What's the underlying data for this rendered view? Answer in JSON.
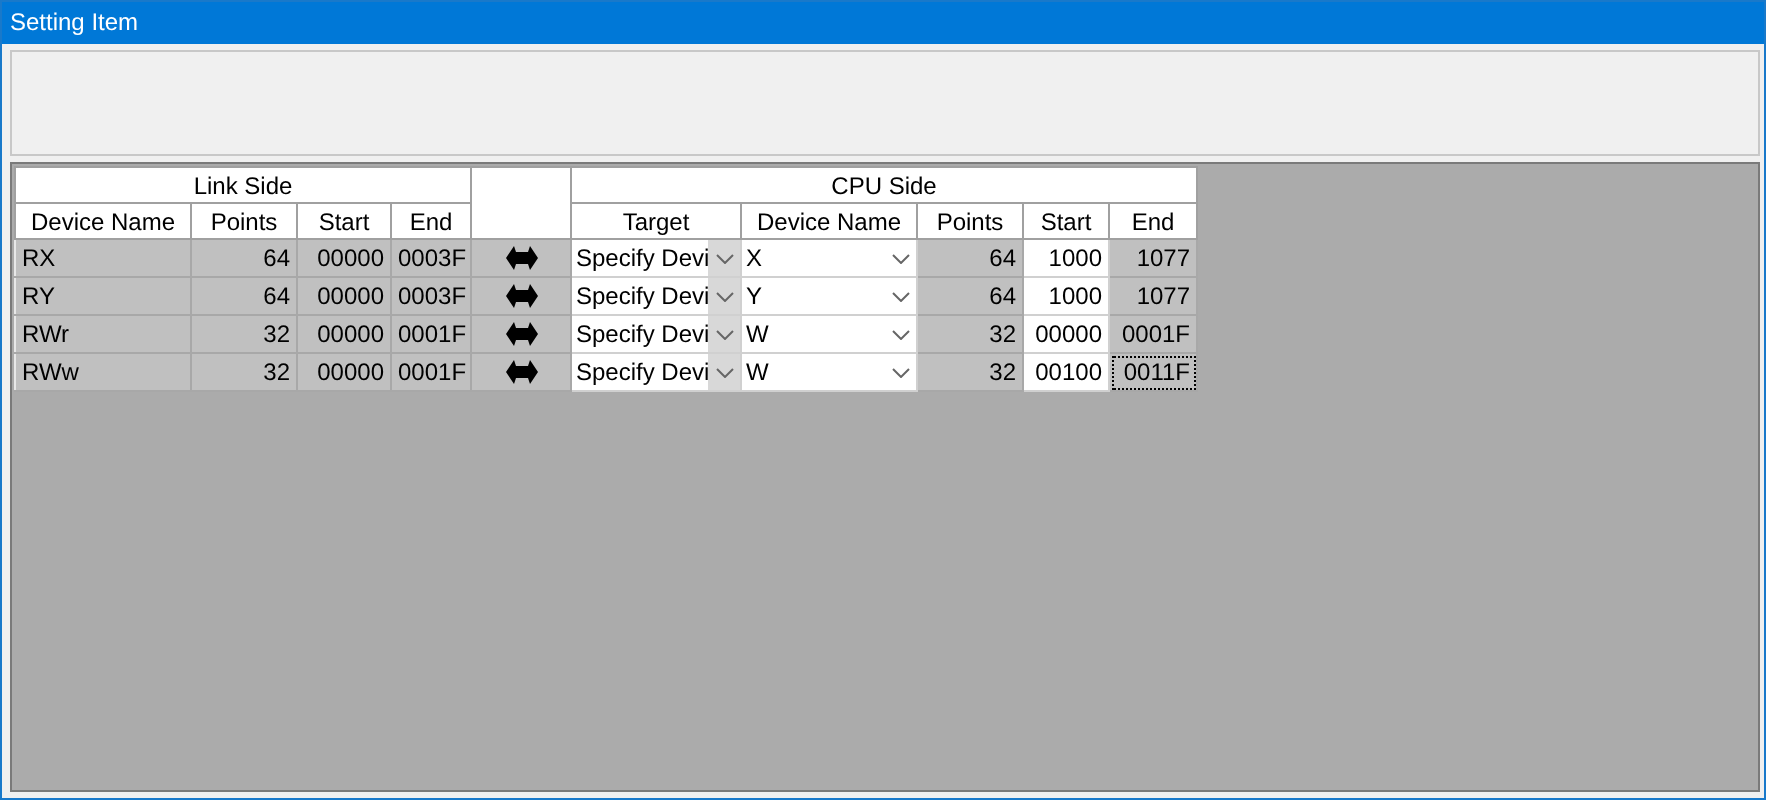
{
  "window": {
    "title": "Setting Item"
  },
  "table": {
    "link_side": "Link Side",
    "cpu_side": "CPU Side",
    "columns": [
      "Device Name",
      "Points",
      "Start",
      "End",
      "Target",
      "Device Name",
      "Points",
      "Start",
      "End"
    ],
    "rows": [
      {
        "link_device": "RX",
        "link_points": "64",
        "link_start": "00000",
        "link_end": "0003F",
        "target": "Specify Devi",
        "cpu_device": "X",
        "cpu_points": "64",
        "cpu_start": "1000",
        "cpu_end": "1077",
        "focused": false
      },
      {
        "link_device": "RY",
        "link_points": "64",
        "link_start": "00000",
        "link_end": "0003F",
        "target": "Specify Devi",
        "cpu_device": "Y",
        "cpu_points": "64",
        "cpu_start": "1000",
        "cpu_end": "1077",
        "focused": false
      },
      {
        "link_device": "RWr",
        "link_points": "32",
        "link_start": "00000",
        "link_end": "0001F",
        "target": "Specify Devi",
        "cpu_device": "W",
        "cpu_points": "32",
        "cpu_start": "00000",
        "cpu_end": "0001F",
        "focused": false
      },
      {
        "link_device": "RWw",
        "link_points": "32",
        "link_start": "00000",
        "link_end": "0001F",
        "target": "Specify Devi",
        "cpu_device": "W",
        "cpu_points": "32",
        "cpu_start": "00100",
        "cpu_end": "0011F",
        "focused": true
      }
    ]
  }
}
